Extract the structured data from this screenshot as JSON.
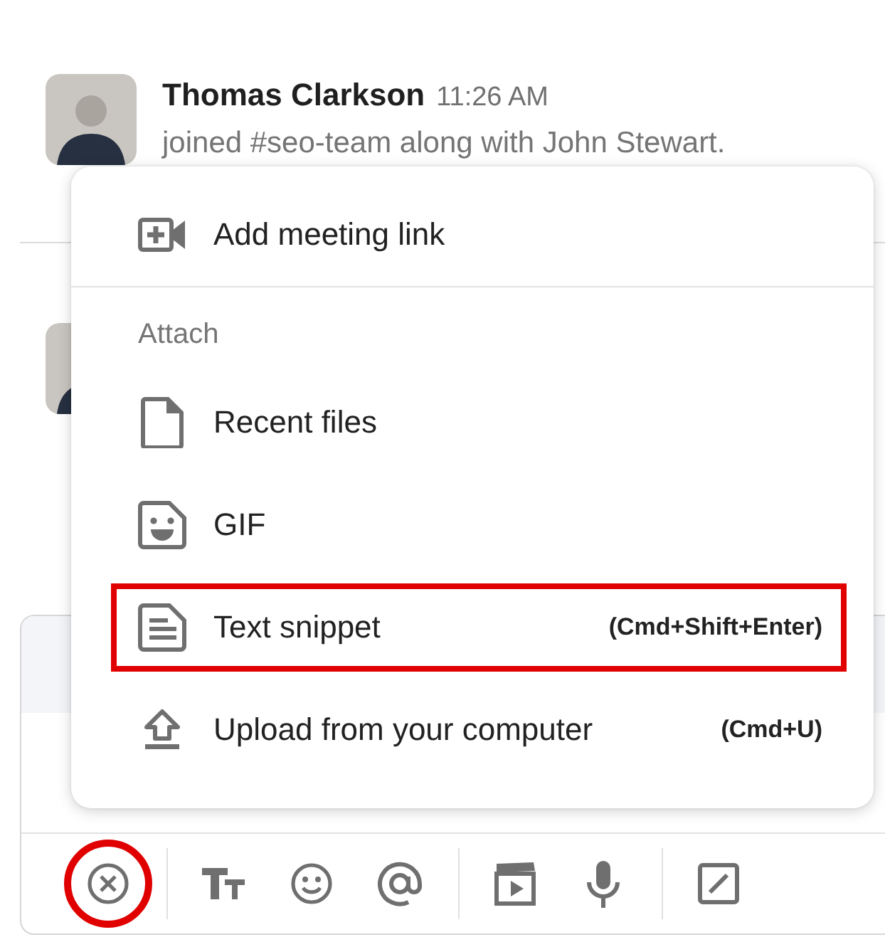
{
  "messages": [
    {
      "kind": "full",
      "name": "Thomas Clarkson",
      "time": "11:26 AM",
      "text": "joined #seo-team along with John Stewart."
    },
    {
      "kind": "covered"
    }
  ],
  "menu": {
    "sections": [
      {
        "items": [
          {
            "kind": "meeting",
            "label": "Add meeting link",
            "highlighted": false
          }
        ]
      },
      {
        "header": "Attach",
        "items": [
          {
            "kind": "file",
            "label": "Recent files",
            "highlighted": false
          },
          {
            "kind": "gif",
            "label": "GIF",
            "highlighted": false
          },
          {
            "kind": "snippet",
            "label": "Text snippet",
            "shortcut": "(Cmd+Shift+Enter)",
            "highlighted": true
          },
          {
            "kind": "upload",
            "label": "Upload from your computer",
            "shortcut": "(Cmd+U)",
            "highlighted": false
          }
        ]
      }
    ]
  },
  "toolbar": [
    {
      "kind": "close",
      "highlighted": true
    },
    {
      "kind": "format",
      "highlighted": false
    },
    {
      "kind": "emoji",
      "highlighted": false
    },
    {
      "kind": "mention",
      "highlighted": false
    },
    {
      "kind": "video",
      "highlighted": false
    },
    {
      "kind": "mic",
      "highlighted": false
    },
    {
      "kind": "edit",
      "highlighted": false
    }
  ]
}
